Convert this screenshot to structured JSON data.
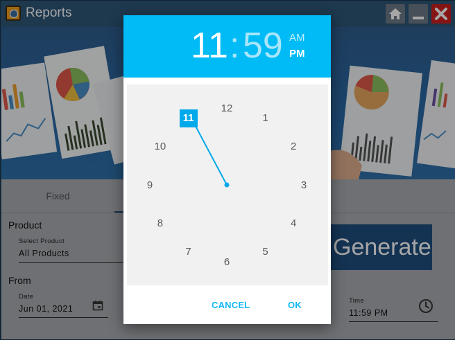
{
  "window": {
    "title": "Reports"
  },
  "panel": {
    "tab_fixed": "Fixed",
    "product_label": "Product",
    "select_product_label": "Select Product",
    "select_product_value": "All Products",
    "from_label": "From",
    "date_label": "Date",
    "date_value": "Jun 01, 2021",
    "time_label": "Time",
    "time_value": "11:59 PM",
    "generate_label": "Generate"
  },
  "time_picker": {
    "hour": "11",
    "separator": ":",
    "minute": "59",
    "am_label": "AM",
    "pm_label": "PM",
    "selected_period": "PM",
    "clock_numbers": [
      "12",
      "1",
      "2",
      "3",
      "4",
      "5",
      "6",
      "7",
      "8",
      "9",
      "10",
      "11"
    ],
    "selected_hour": "11",
    "cancel_label": "CANCEL",
    "ok_label": "OK",
    "accent_color": "#00bbf5"
  }
}
